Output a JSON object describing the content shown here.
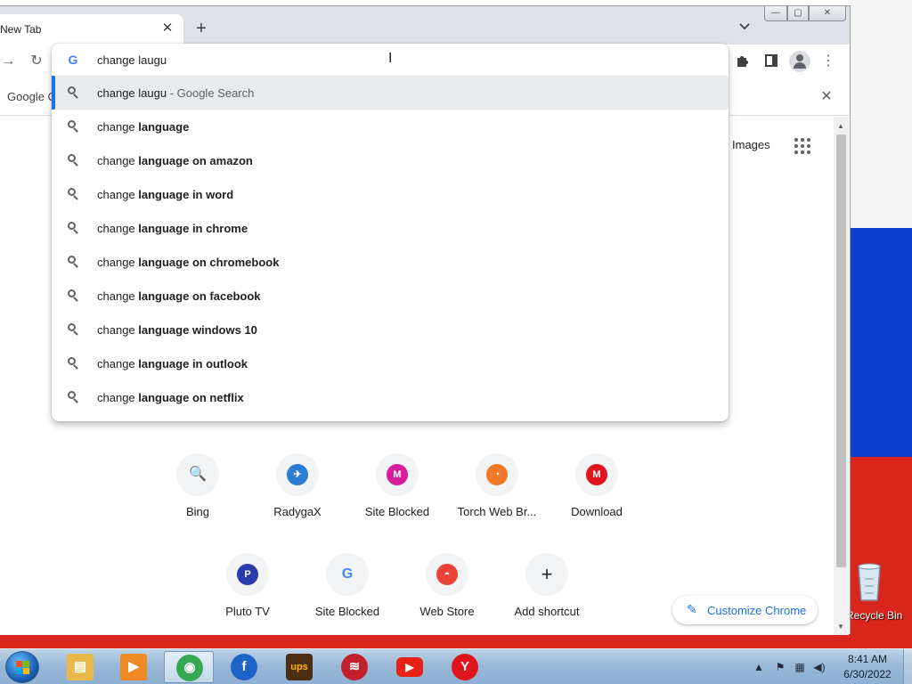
{
  "window": {
    "tab_title": "New Tab",
    "tab_close_icon": "close-icon",
    "new_tab_label": "+",
    "tab_search_label": "⌄",
    "controls": {
      "minimize": "—",
      "maximize": "▢",
      "close": "✕"
    }
  },
  "toolbar": {
    "forward_icon": "→",
    "reload_icon": "↻",
    "extensions_icon": "puzzle-icon",
    "sidepanel_icon": "▮",
    "menu_icon": "⋮"
  },
  "infobar": {
    "text": "Google C",
    "close_label": "✕"
  },
  "omnibox": {
    "g_logo": "G",
    "input_value": "change laugu",
    "cursor": "I",
    "suggestions": [
      {
        "prefix": "change laugu",
        "bold": "",
        "hint": " - Google Search"
      },
      {
        "prefix": "change ",
        "bold": "language",
        "hint": ""
      },
      {
        "prefix": "change ",
        "bold": "language on amazon",
        "hint": ""
      },
      {
        "prefix": "change ",
        "bold": "language in word",
        "hint": ""
      },
      {
        "prefix": "change ",
        "bold": "language in chrome",
        "hint": ""
      },
      {
        "prefix": "change ",
        "bold": "language on chromebook",
        "hint": ""
      },
      {
        "prefix": "change ",
        "bold": "language on facebook",
        "hint": ""
      },
      {
        "prefix": "change ",
        "bold": "language windows 10",
        "hint": ""
      },
      {
        "prefix": "change ",
        "bold": "language in outlook",
        "hint": ""
      },
      {
        "prefix": "change ",
        "bold": "language on netflix",
        "hint": ""
      }
    ]
  },
  "page": {
    "images_link": "Images",
    "shortcuts_row1": [
      {
        "label": "Bing",
        "glyph": "🔍",
        "color": "#1a73e8"
      },
      {
        "label": "RadygaX",
        "glyph": "✈",
        "color": "#2b7cd3"
      },
      {
        "label": "Site Blocked",
        "glyph": "M",
        "color": "#d41e9a"
      },
      {
        "label": "Torch Web Br...",
        "glyph": "◔",
        "color": "#f2792c"
      },
      {
        "label": "Download",
        "glyph": "M",
        "color": "#e0141e"
      }
    ],
    "shortcuts_row2": [
      {
        "label": "Pluto TV",
        "glyph": "P",
        "color": "#2a3bab"
      },
      {
        "label": "Site Blocked",
        "glyph": "G",
        "color": "#4285f4"
      },
      {
        "label": "Web Store",
        "glyph": "◓",
        "color": "#ea4335"
      },
      {
        "label": "Add shortcut",
        "glyph": "+",
        "color": "#202124"
      }
    ],
    "customize_label": "Customize Chrome",
    "customize_icon": "✎"
  },
  "desktop": {
    "recycle_bin_label": "Recycle Bin",
    "colors": {
      "white": "#f5f5f5",
      "blue": "#0f3ecf",
      "red": "#d8261d"
    }
  },
  "taskbar": {
    "apps": [
      {
        "name": "explorer",
        "glyph": "▤",
        "color": "#e8b94a"
      },
      {
        "name": "media-player",
        "glyph": "▶",
        "color": "#f08a24"
      },
      {
        "name": "chrome",
        "glyph": "◉",
        "color": "#34a853"
      },
      {
        "name": "firefox",
        "glyph": "f",
        "color": "#1e64c8"
      },
      {
        "name": "ups",
        "glyph": "ups",
        "color": "#4b2e14"
      },
      {
        "name": "bank",
        "glyph": "≋",
        "color": "#c2202f"
      },
      {
        "name": "youtube",
        "glyph": "▶",
        "color": "#e62117"
      },
      {
        "name": "yandex",
        "glyph": "Y",
        "color": "#e0141e"
      }
    ],
    "tray_arrow": "▲",
    "clock_time": "8:41 AM",
    "clock_date": "6/30/2022"
  }
}
